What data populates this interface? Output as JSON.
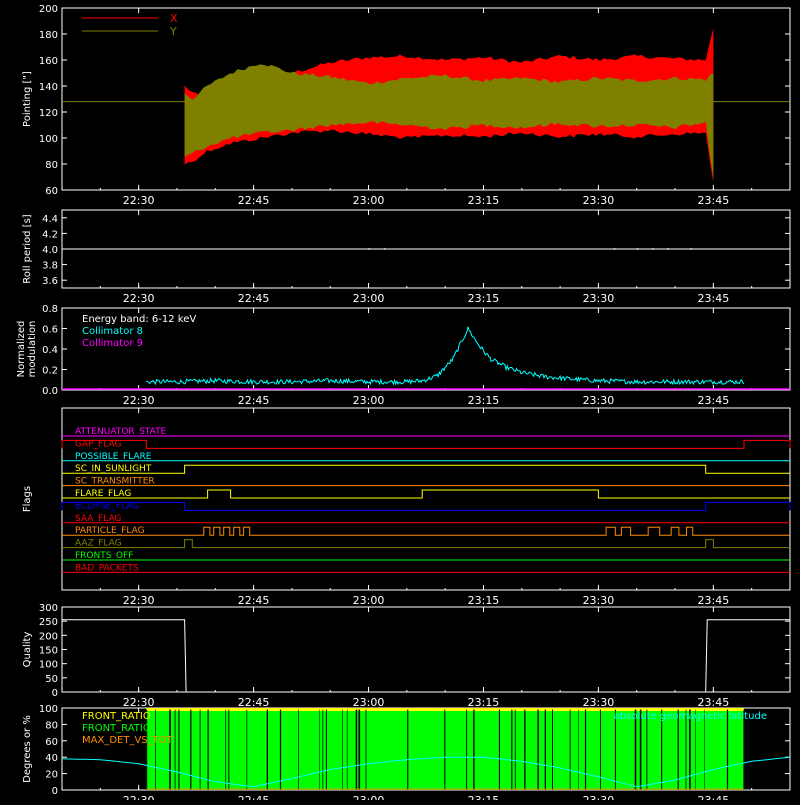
{
  "colors": {
    "background": "#000000",
    "axes": "#ffffff",
    "pointing_x": "#ff0000",
    "pointing_y": "#808000",
    "collimator_8": "#00ffff",
    "collimator_9": "#ff00ff",
    "quality": "#ffffff",
    "front_ratio": "#ffff00",
    "front_ratio_2": "#00ff00",
    "max_det": "#ff8c00",
    "geomag": "#00ffff"
  },
  "x_axis": {
    "start_time": "22:20",
    "end_time": "23:55",
    "tick_labels": [
      "22:30",
      "22:45",
      "23:00",
      "23:15",
      "23:30",
      "23:45"
    ],
    "tick_minutes": [
      10,
      25,
      40,
      55,
      70,
      85
    ]
  },
  "chart_data": [
    {
      "type": "area",
      "id": "pointing",
      "ylabel": "Pointing [\"]",
      "ylim": [
        60,
        200
      ],
      "yticks": [
        60,
        80,
        100,
        120,
        140,
        160,
        180,
        200
      ],
      "legend": [
        {
          "label": "X",
          "color": "#ff0000"
        },
        {
          "label": "Y",
          "color": "#808000"
        }
      ],
      "baseline_value": 128,
      "series": [
        {
          "name": "X",
          "x_minutes": [
            16,
            17,
            19,
            22,
            26,
            30,
            35,
            40,
            45,
            50,
            55,
            60,
            65,
            70,
            75,
            80,
            84,
            85
          ],
          "y_max": [
            140,
            135,
            128,
            138,
            148,
            150,
            158,
            162,
            163,
            160,
            162,
            158,
            163,
            160,
            163,
            161,
            160,
            185
          ],
          "y_min": [
            80,
            82,
            90,
            96,
            100,
            104,
            106,
            103,
            100,
            102,
            101,
            104,
            101,
            103,
            101,
            103,
            104,
            65
          ]
        },
        {
          "name": "Y",
          "x_minutes": [
            16,
            17,
            19,
            22,
            26,
            30,
            35,
            40,
            45,
            50,
            55,
            60,
            65,
            70,
            75,
            80,
            84,
            85
          ],
          "y_max": [
            135,
            130,
            140,
            150,
            158,
            150,
            147,
            142,
            146,
            148,
            144,
            146,
            143,
            146,
            144,
            146,
            145,
            150
          ],
          "y_min": [
            85,
            88,
            94,
            100,
            104,
            106,
            110,
            112,
            110,
            107,
            110,
            108,
            111,
            109,
            110,
            108,
            112,
            68
          ]
        }
      ]
    },
    {
      "type": "line",
      "id": "roll",
      "ylabel": "Roll period [s]",
      "ylim": [
        3.5,
        4.5
      ],
      "yticks": [
        3.6,
        3.8,
        4.0,
        4.2,
        4.4
      ],
      "ytick_labels": [
        "3.6",
        "3.8",
        "4.0",
        "4.2",
        "4.4"
      ],
      "series": [
        {
          "name": "",
          "x_minutes": [
            0,
            95
          ],
          "y": [
            4.0,
            4.0
          ]
        }
      ]
    },
    {
      "type": "line",
      "id": "modulation",
      "ylabel": "Normalized modulation",
      "ylabel_lines": [
        "Normalized",
        "modulation"
      ],
      "ylim": [
        0,
        0.8
      ],
      "yticks": [
        0.0,
        0.2,
        0.4,
        0.6,
        0.8
      ],
      "ytick_labels": [
        "0.0",
        "0.2",
        "0.4",
        "0.6",
        "0.8"
      ],
      "annotation": "Energy band: 6-12 keV",
      "legend": [
        {
          "label": "Collimator 8",
          "color": "#00ffff"
        },
        {
          "label": "Collimator 9",
          "color": "#ff00ff"
        }
      ],
      "series": [
        {
          "name": "Collimator 8",
          "x_minutes": [
            11,
            15,
            20,
            25,
            30,
            35,
            40,
            45,
            47,
            49,
            51,
            52,
            53,
            54,
            55,
            56,
            58,
            60,
            63,
            66,
            70,
            75,
            80,
            85,
            89
          ],
          "y": [
            0.08,
            0.08,
            0.09,
            0.08,
            0.08,
            0.09,
            0.08,
            0.08,
            0.09,
            0.14,
            0.3,
            0.45,
            0.6,
            0.48,
            0.38,
            0.3,
            0.22,
            0.17,
            0.13,
            0.11,
            0.09,
            0.08,
            0.08,
            0.08,
            0.08
          ]
        },
        {
          "name": "Collimator 9",
          "x_minutes": [
            0,
            95
          ],
          "y": [
            0.0,
            0.0
          ]
        }
      ]
    },
    {
      "type": "table",
      "id": "flags",
      "ylabel": "Flags",
      "rows": [
        {
          "name": "ATTENUATOR_STATE",
          "color": "#ff00ff",
          "intervals": []
        },
        {
          "name": "GAP_FLAG",
          "color": "#ff0000",
          "intervals": [
            [
              0,
              11
            ],
            [
              89,
              95
            ]
          ]
        },
        {
          "name": "POSSIBLE_FLARE",
          "color": "#00ffff",
          "intervals": []
        },
        {
          "name": "SC_IN_SUNLIGHT",
          "color": "#ffff00",
          "intervals": [
            [
              16,
              84
            ]
          ]
        },
        {
          "name": "SC_TRANSMITTER",
          "color": "#ff8c00",
          "intervals": []
        },
        {
          "name": "FLARE_FLAG",
          "color": "#ffff00",
          "intervals": [
            [
              19,
              22
            ],
            [
              47,
              70
            ]
          ]
        },
        {
          "name": "ECLIPSE_FLAG",
          "color": "#0000ff",
          "intervals": [
            [
              0,
              16
            ],
            [
              84,
              95
            ]
          ]
        },
        {
          "name": "SAA_FLAG",
          "color": "#ff0000",
          "intervals": []
        },
        {
          "name": "PARTICLE_FLAG",
          "color": "#ff8c00",
          "intervals": [
            [
              18.5,
              19.3
            ],
            [
              19.8,
              20.6
            ],
            [
              21.1,
              21.9
            ],
            [
              22.4,
              23.2
            ],
            [
              23.7,
              24.5
            ],
            [
              71,
              72.2
            ],
            [
              73,
              74.2
            ],
            [
              76.5,
              78
            ],
            [
              79.5,
              80.5
            ],
            [
              81.5,
              82.3
            ]
          ]
        },
        {
          "name": "AAZ_FLAG",
          "color": "#808000",
          "intervals": [
            [
              16,
              17
            ],
            [
              84,
              85
            ]
          ]
        },
        {
          "name": "FRONTS_OFF",
          "color": "#00ff00",
          "intervals": []
        },
        {
          "name": "BAD_PACKETS",
          "color": "#ff0000",
          "intervals": []
        }
      ]
    },
    {
      "type": "line",
      "id": "quality",
      "ylabel": "Quality",
      "ylim": [
        0,
        300
      ],
      "yticks": [
        0,
        50,
        100,
        150,
        200,
        250,
        300
      ],
      "series": [
        {
          "name": "",
          "x_minutes": [
            0,
            16,
            16.2,
            84,
            84.2,
            95
          ],
          "y": [
            255,
            255,
            0,
            0,
            255,
            255
          ]
        }
      ]
    },
    {
      "type": "bar",
      "id": "ratios",
      "ylabel": "Degrees or %",
      "ylim": [
        0,
        100
      ],
      "yticks": [
        0,
        20,
        40,
        60,
        80,
        100
      ],
      "legend": [
        {
          "label": "FRONT_RATIO",
          "color": "#ffff00"
        },
        {
          "label": "FRONT_RATIO_2",
          "color": "#00ff00"
        },
        {
          "label": "MAX_DET_VS_TOT",
          "color": "#ff8c00"
        },
        {
          "label": "absolute geomagnetic latitude",
          "color": "#00ffff"
        }
      ],
      "front_ratio_range": [
        11,
        89
      ],
      "front_ratio_value": 100,
      "geomag_latitude": {
        "x_minutes": [
          0,
          5,
          10,
          15,
          20,
          25,
          30,
          35,
          40,
          45,
          50,
          55,
          60,
          65,
          70,
          75,
          80,
          85,
          90,
          95
        ],
        "y": [
          38,
          37,
          32,
          22,
          10,
          4,
          14,
          25,
          32,
          37,
          40,
          40,
          35,
          27,
          16,
          4,
          12,
          25,
          35,
          40
        ]
      }
    }
  ]
}
